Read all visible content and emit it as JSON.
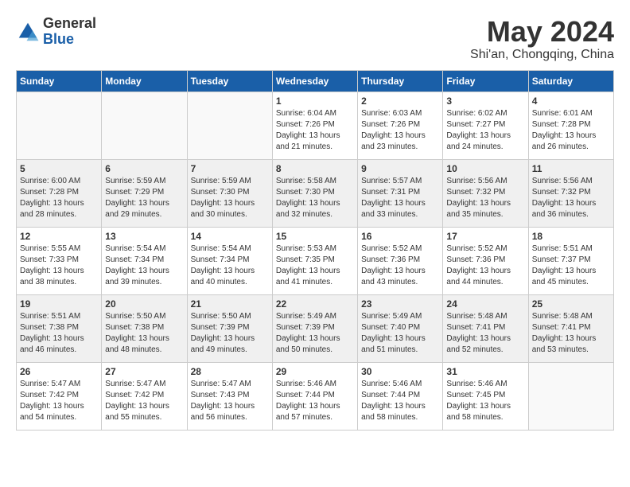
{
  "logo": {
    "general": "General",
    "blue": "Blue"
  },
  "title": "May 2024",
  "location": "Shi'an, Chongqing, China",
  "days_of_week": [
    "Sunday",
    "Monday",
    "Tuesday",
    "Wednesday",
    "Thursday",
    "Friday",
    "Saturday"
  ],
  "weeks": [
    [
      {
        "num": "",
        "info": ""
      },
      {
        "num": "",
        "info": ""
      },
      {
        "num": "",
        "info": ""
      },
      {
        "num": "1",
        "info": "Sunrise: 6:04 AM\nSunset: 7:26 PM\nDaylight: 13 hours\nand 21 minutes."
      },
      {
        "num": "2",
        "info": "Sunrise: 6:03 AM\nSunset: 7:26 PM\nDaylight: 13 hours\nand 23 minutes."
      },
      {
        "num": "3",
        "info": "Sunrise: 6:02 AM\nSunset: 7:27 PM\nDaylight: 13 hours\nand 24 minutes."
      },
      {
        "num": "4",
        "info": "Sunrise: 6:01 AM\nSunset: 7:28 PM\nDaylight: 13 hours\nand 26 minutes."
      }
    ],
    [
      {
        "num": "5",
        "info": "Sunrise: 6:00 AM\nSunset: 7:28 PM\nDaylight: 13 hours\nand 28 minutes."
      },
      {
        "num": "6",
        "info": "Sunrise: 5:59 AM\nSunset: 7:29 PM\nDaylight: 13 hours\nand 29 minutes."
      },
      {
        "num": "7",
        "info": "Sunrise: 5:59 AM\nSunset: 7:30 PM\nDaylight: 13 hours\nand 30 minutes."
      },
      {
        "num": "8",
        "info": "Sunrise: 5:58 AM\nSunset: 7:30 PM\nDaylight: 13 hours\nand 32 minutes."
      },
      {
        "num": "9",
        "info": "Sunrise: 5:57 AM\nSunset: 7:31 PM\nDaylight: 13 hours\nand 33 minutes."
      },
      {
        "num": "10",
        "info": "Sunrise: 5:56 AM\nSunset: 7:32 PM\nDaylight: 13 hours\nand 35 minutes."
      },
      {
        "num": "11",
        "info": "Sunrise: 5:56 AM\nSunset: 7:32 PM\nDaylight: 13 hours\nand 36 minutes."
      }
    ],
    [
      {
        "num": "12",
        "info": "Sunrise: 5:55 AM\nSunset: 7:33 PM\nDaylight: 13 hours\nand 38 minutes."
      },
      {
        "num": "13",
        "info": "Sunrise: 5:54 AM\nSunset: 7:34 PM\nDaylight: 13 hours\nand 39 minutes."
      },
      {
        "num": "14",
        "info": "Sunrise: 5:54 AM\nSunset: 7:34 PM\nDaylight: 13 hours\nand 40 minutes."
      },
      {
        "num": "15",
        "info": "Sunrise: 5:53 AM\nSunset: 7:35 PM\nDaylight: 13 hours\nand 41 minutes."
      },
      {
        "num": "16",
        "info": "Sunrise: 5:52 AM\nSunset: 7:36 PM\nDaylight: 13 hours\nand 43 minutes."
      },
      {
        "num": "17",
        "info": "Sunrise: 5:52 AM\nSunset: 7:36 PM\nDaylight: 13 hours\nand 44 minutes."
      },
      {
        "num": "18",
        "info": "Sunrise: 5:51 AM\nSunset: 7:37 PM\nDaylight: 13 hours\nand 45 minutes."
      }
    ],
    [
      {
        "num": "19",
        "info": "Sunrise: 5:51 AM\nSunset: 7:38 PM\nDaylight: 13 hours\nand 46 minutes."
      },
      {
        "num": "20",
        "info": "Sunrise: 5:50 AM\nSunset: 7:38 PM\nDaylight: 13 hours\nand 48 minutes."
      },
      {
        "num": "21",
        "info": "Sunrise: 5:50 AM\nSunset: 7:39 PM\nDaylight: 13 hours\nand 49 minutes."
      },
      {
        "num": "22",
        "info": "Sunrise: 5:49 AM\nSunset: 7:39 PM\nDaylight: 13 hours\nand 50 minutes."
      },
      {
        "num": "23",
        "info": "Sunrise: 5:49 AM\nSunset: 7:40 PM\nDaylight: 13 hours\nand 51 minutes."
      },
      {
        "num": "24",
        "info": "Sunrise: 5:48 AM\nSunset: 7:41 PM\nDaylight: 13 hours\nand 52 minutes."
      },
      {
        "num": "25",
        "info": "Sunrise: 5:48 AM\nSunset: 7:41 PM\nDaylight: 13 hours\nand 53 minutes."
      }
    ],
    [
      {
        "num": "26",
        "info": "Sunrise: 5:47 AM\nSunset: 7:42 PM\nDaylight: 13 hours\nand 54 minutes."
      },
      {
        "num": "27",
        "info": "Sunrise: 5:47 AM\nSunset: 7:42 PM\nDaylight: 13 hours\nand 55 minutes."
      },
      {
        "num": "28",
        "info": "Sunrise: 5:47 AM\nSunset: 7:43 PM\nDaylight: 13 hours\nand 56 minutes."
      },
      {
        "num": "29",
        "info": "Sunrise: 5:46 AM\nSunset: 7:44 PM\nDaylight: 13 hours\nand 57 minutes."
      },
      {
        "num": "30",
        "info": "Sunrise: 5:46 AM\nSunset: 7:44 PM\nDaylight: 13 hours\nand 58 minutes."
      },
      {
        "num": "31",
        "info": "Sunrise: 5:46 AM\nSunset: 7:45 PM\nDaylight: 13 hours\nand 58 minutes."
      },
      {
        "num": "",
        "info": ""
      }
    ]
  ]
}
